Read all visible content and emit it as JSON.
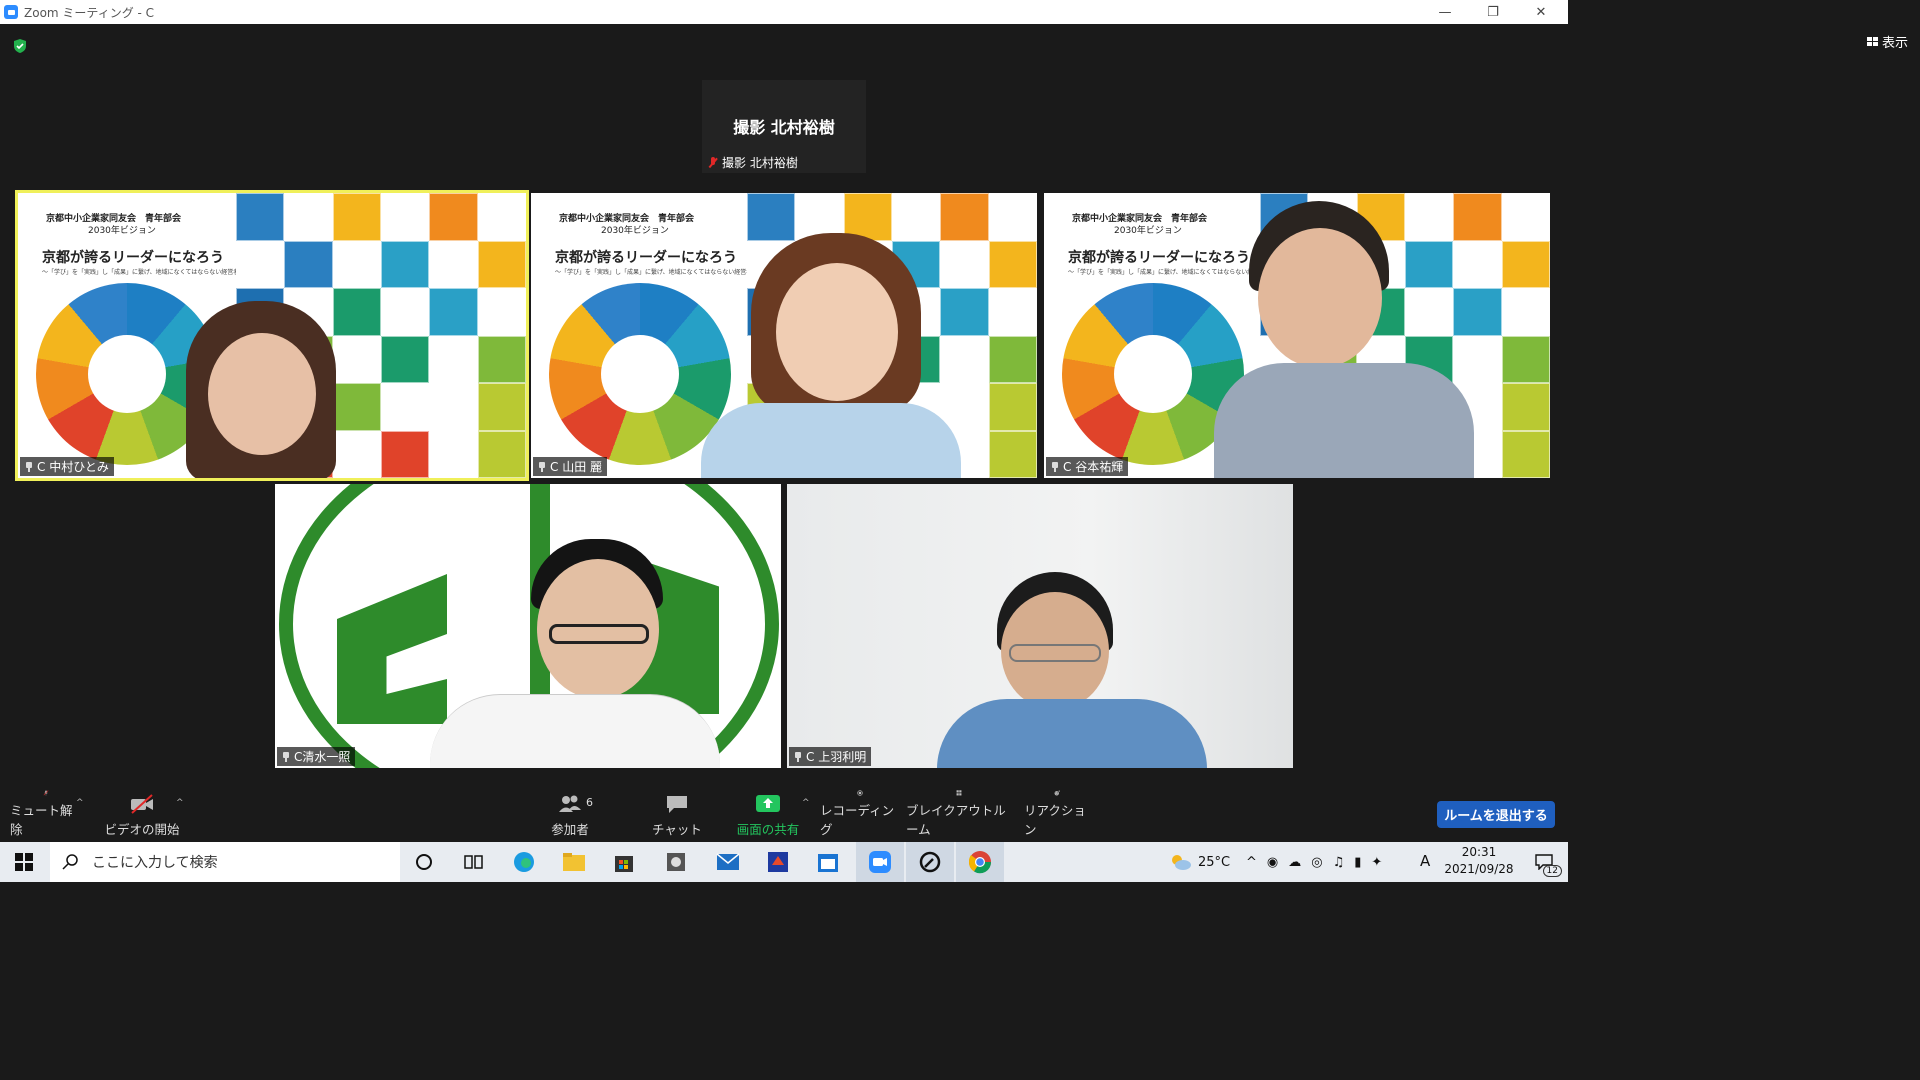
{
  "window": {
    "title": "Zoom ミーティング - C"
  },
  "view_button": {
    "label": "表示"
  },
  "photo_tile": {
    "big_label": "撮影 北村裕樹",
    "name_label": "撮影 北村裕樹"
  },
  "participants": [
    {
      "name": "C 中村ひとみ"
    },
    {
      "name": "C 山田 麗"
    },
    {
      "name": "C 谷本祐輝"
    },
    {
      "name": "C清水一照"
    },
    {
      "name": "C 上羽利明"
    }
  ],
  "slide": {
    "org": "京都中小企業家同友会　青年部会",
    "vision": "2030年ビジョン",
    "headline": "京都が誇るリーダーになろう",
    "subheadline": "〜「学び」を「実践」し「成果」に繋げ、地域になくてはならない経営者へ〜"
  },
  "toolbar": {
    "mute_label": "ミュート解除",
    "video_label": "ビデオの開始",
    "participants_label": "参加者",
    "participants_count": "6",
    "chat_label": "チャット",
    "share_label": "画面の共有",
    "record_label": "レコーディング",
    "breakout_label": "ブレイクアウトルーム",
    "reaction_label": "リアクション",
    "leave_label": "ルームを退出する"
  },
  "taskbar": {
    "search_placeholder": "ここに入力して検索",
    "weather": "25°C",
    "ime": "A",
    "time": "20:31",
    "date": "2021/09/28",
    "notifications": "12"
  },
  "colors": {
    "active_border": "#f0f05a",
    "share_green": "#23c55e",
    "leave_blue": "#1f5fbf",
    "zoom_blue": "#2D8CFF"
  }
}
